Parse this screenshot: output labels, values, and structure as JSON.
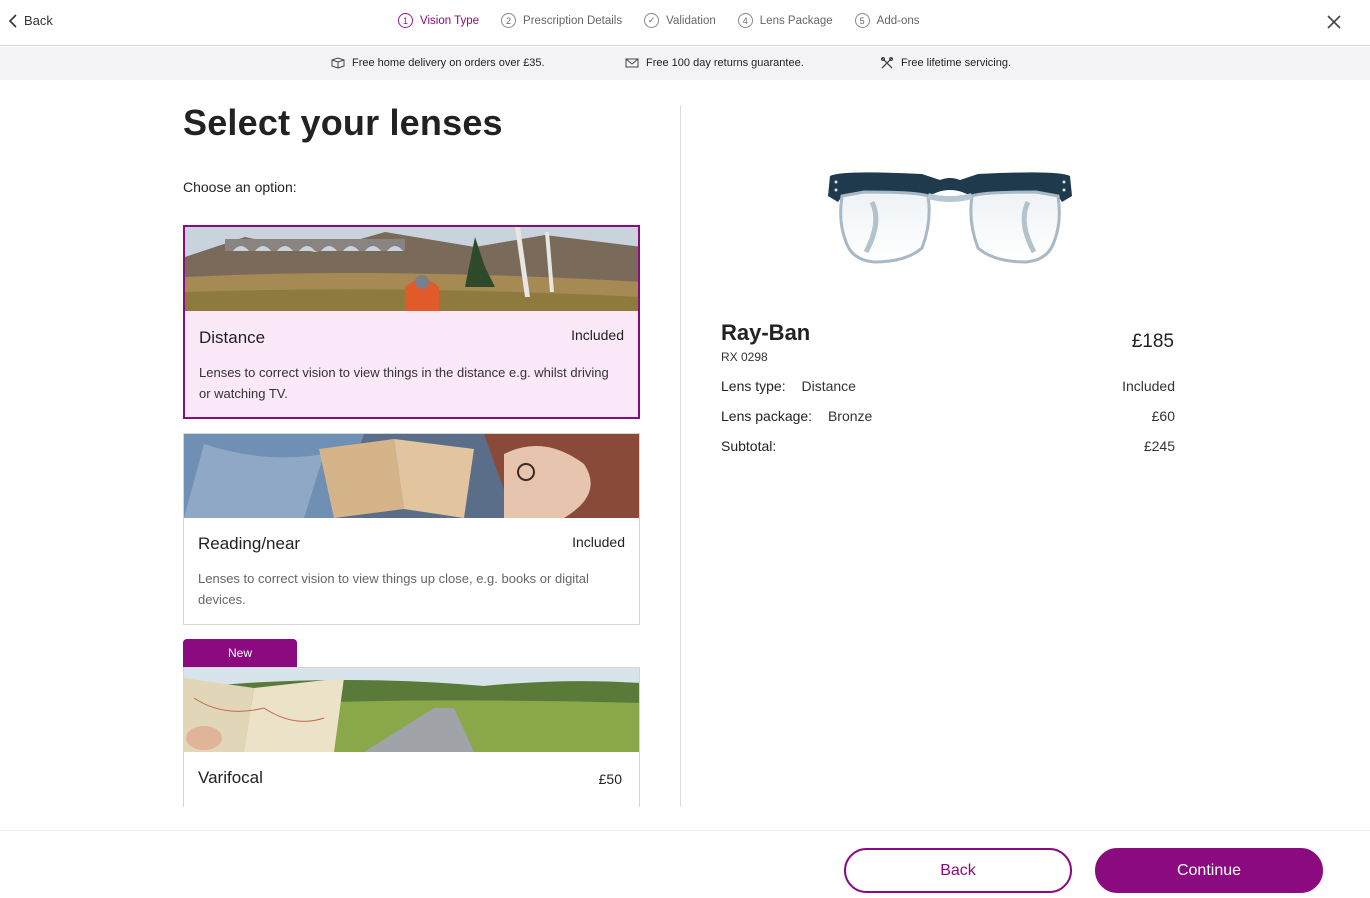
{
  "header": {
    "back_label": "Back",
    "steps": [
      {
        "num": "1",
        "label": "Vision Type",
        "active": true
      },
      {
        "num": "2",
        "label": "Prescription Details"
      },
      {
        "num": "✓",
        "label": "Validation"
      },
      {
        "num": "4",
        "label": "Lens Package"
      },
      {
        "num": "5",
        "label": "Add-ons"
      }
    ]
  },
  "infobar": {
    "delivery": "Free home delivery on orders over £35.",
    "returns": "Free 100 day returns guarantee.",
    "servicing": "Free lifetime servicing."
  },
  "main": {
    "title": "Select your lenses",
    "prompt": "Choose an option:",
    "options": [
      {
        "title": "Distance",
        "price": "Included",
        "desc": "Lenses to correct vision to view things in the distance e.g. whilst driving or watching TV.",
        "selected": true
      },
      {
        "title": "Reading/near",
        "price": "Included",
        "desc": "Lenses to correct vision to view things up close, e.g. books or digital devices."
      },
      {
        "title": "Varifocal",
        "price": "£50",
        "badge": "New"
      }
    ]
  },
  "summary": {
    "brand": "Ray-Ban",
    "model": "RX 0298",
    "frame_price": "£185",
    "lens_type_label": "Lens type:",
    "lens_type_value": "Distance",
    "lens_type_price": "Included",
    "lens_package_label": "Lens package:",
    "lens_package_value": "Bronze",
    "lens_package_price": "£60",
    "subtotal_label": "Subtotal:",
    "subtotal_value": "£245"
  },
  "footer": {
    "back_label": "Back",
    "continue_label": "Continue"
  },
  "colors": {
    "accent": "#8b0a80",
    "selected_bg": "#fbe8f9",
    "infobar_bg": "#f3f3f5"
  }
}
